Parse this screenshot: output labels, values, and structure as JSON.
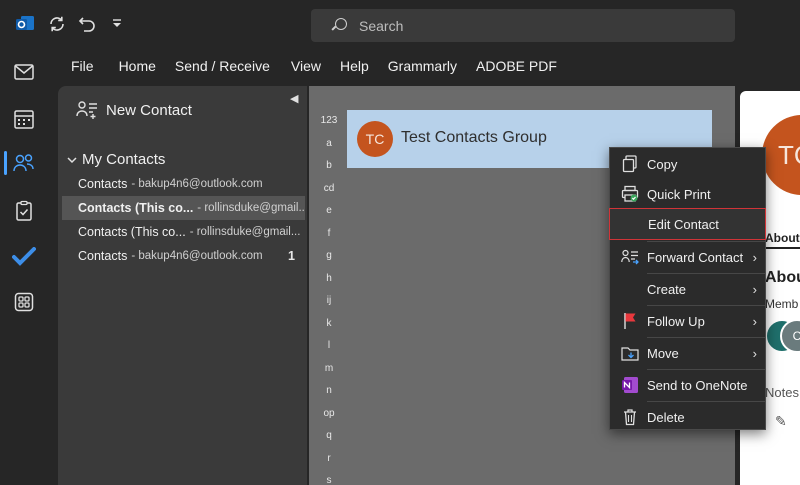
{
  "titlebar": {
    "search_placeholder": "Search"
  },
  "menu": [
    "File",
    "Home",
    "Send / Receive",
    "View",
    "Help",
    "Grammarly",
    "ADOBE PDF"
  ],
  "folder_pane": {
    "new_contact": "New Contact",
    "my_contacts": "My Contacts",
    "accounts": [
      {
        "name": "Contacts",
        "email": "- bakup4n6@outlook.com",
        "count": ""
      },
      {
        "name": "Contacts (This co...",
        "email": "- rollinsduke@gmail...",
        "count": ""
      },
      {
        "name": "Contacts (This co...",
        "email": "- rollinsduke@gmail...",
        "count": ""
      },
      {
        "name": "Contacts",
        "email": "- bakup4n6@outlook.com",
        "count": "1"
      }
    ]
  },
  "contact_list": {
    "alpha_index": [
      "123",
      "a",
      "b",
      "cd",
      "e",
      "f",
      "g",
      "h",
      "ij",
      "k",
      "l",
      "m",
      "n",
      "op",
      "q",
      "r",
      "s"
    ],
    "contact": {
      "initials": "TC",
      "name": "Test Contacts Group"
    }
  },
  "reading_pane": {
    "initials": "TC",
    "tab": "About",
    "heading": "About",
    "members_label": "Memb",
    "member_initial_1": "",
    "member_initial_2": "C",
    "notes_label": "Notes"
  },
  "context_menu": {
    "copy": "Copy",
    "quick_print": "Quick Print",
    "edit_contact": "Edit Contact",
    "forward_contact": "Forward Contact",
    "create": "Create",
    "follow_up": "Follow Up",
    "move": "Move",
    "send_to_onenote": "Send to OneNote",
    "delete": "Delete"
  },
  "colors": {
    "accent": "#4aa3ff",
    "avatar": "#c4541e",
    "selection": "#b7d1ea",
    "highlight_border": "#d13438",
    "onenote": "#7719aa",
    "flag": "#e8383d"
  }
}
